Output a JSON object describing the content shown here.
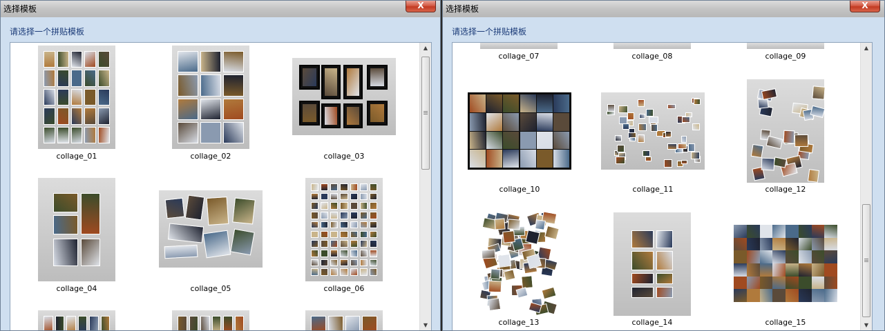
{
  "windows": [
    {
      "title": "选择模板",
      "close_label": "X",
      "prompt": "请选择一个拼贴模板",
      "items": [
        {
          "label": "collage_01"
        },
        {
          "label": "collage_02"
        },
        {
          "label": "collage_03"
        },
        {
          "label": "collage_04"
        },
        {
          "label": "collage_05"
        },
        {
          "label": "collage_06"
        }
      ]
    },
    {
      "title": "选择模板",
      "close_label": "X",
      "prompt": "请选择一个拼贴模板",
      "items": [
        {
          "label": "collage_07"
        },
        {
          "label": "collage_08"
        },
        {
          "label": "collage_09"
        },
        {
          "label": "collage_10"
        },
        {
          "label": "collage_11"
        },
        {
          "label": "collage_12"
        },
        {
          "label": "collage_13"
        },
        {
          "label": "collage_14"
        },
        {
          "label": "collage_15"
        }
      ]
    }
  ],
  "colors": {
    "photo_palette": [
      "#5a4a3a",
      "#b07a3c",
      "#2a3a5a",
      "#d8dde6",
      "#7a5a2a",
      "#3b4c2b",
      "#c9b48a",
      "#1e2230",
      "#8a9ab0",
      "#a04a20",
      "#e0e4ea",
      "#4a6a8a"
    ]
  }
}
